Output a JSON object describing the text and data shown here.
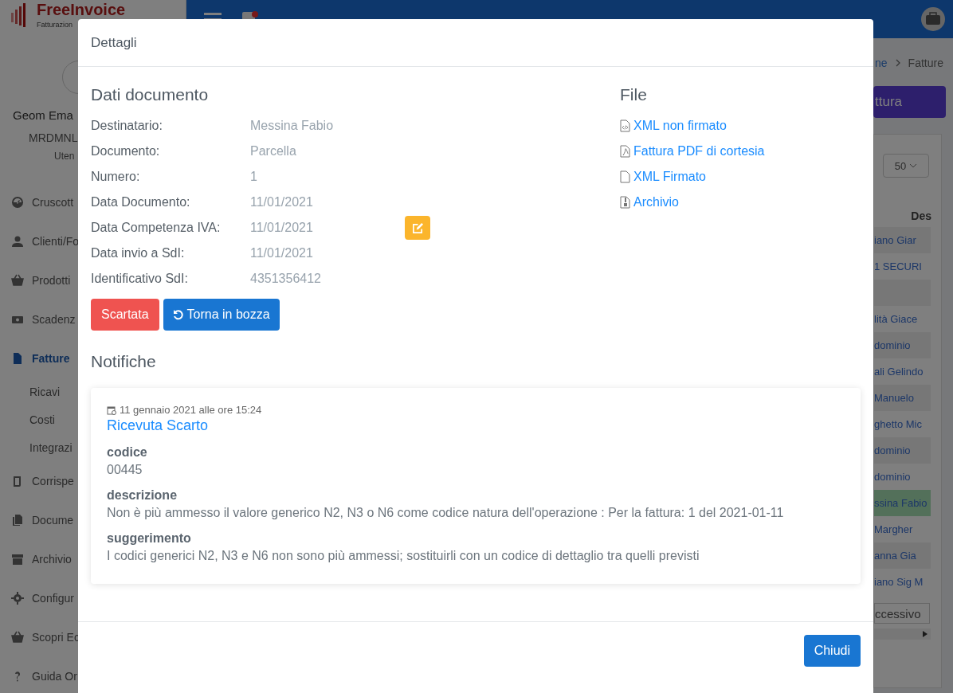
{
  "app": {
    "logo": {
      "name": "FreeInvoice",
      "tagline": "Fatturazion"
    },
    "user": {
      "name": "Geom Ema",
      "code": "MRDMNL",
      "role": "Uten"
    },
    "sidebar": {
      "items": [
        {
          "label": "Cruscott",
          "selected": false
        },
        {
          "label": "Clienti/Fo",
          "selected": false
        },
        {
          "label": "Prodotti",
          "selected": false
        },
        {
          "label": "Scadenz",
          "selected": false
        },
        {
          "label": "Fatture",
          "selected": true,
          "children": [
            {
              "label": "Ricavi"
            },
            {
              "label": "Costi"
            },
            {
              "label": "Integrazi"
            }
          ]
        },
        {
          "label": "Corrispe",
          "selected": false
        },
        {
          "label": "Docume",
          "selected": false
        },
        {
          "label": "Archivio",
          "selected": false
        },
        {
          "label": "Configur",
          "selected": false
        },
        {
          "label": "Scopri Ec",
          "selected": false
        },
        {
          "label": "Guida Or",
          "selected": false
        }
      ]
    }
  },
  "background": {
    "breadcrumb": [
      "ne",
      "Fatture"
    ],
    "new_button": "ttura",
    "page_size": "50",
    "column_header": "Des",
    "rows": [
      {
        "text": "iano Giar",
        "selected": false
      },
      {
        "text": "1 SECURI",
        "selected": false
      },
      {
        "selected": false
      },
      {
        "text": "lità Giace",
        "selected": false
      },
      {
        "text": "dominio",
        "selected": false
      },
      {
        "text": "ali Gelindo",
        "selected": false
      },
      {
        "text": "Manuelo",
        "selected": false
      },
      {
        "text": "ghetto Mic",
        "selected": false
      },
      {
        "text": "dominio",
        "selected": false
      },
      {
        "text": "dominio",
        "selected": false
      },
      {
        "text": "ssina Fabio",
        "selected": true
      },
      {
        "text": "Margher",
        "selected": false
      },
      {
        "text": "anna Gia",
        "selected": false
      },
      {
        "text": "iano Sig M",
        "selected": false
      }
    ],
    "next_button": "ccessivo"
  },
  "dialog": {
    "title": "Dettagli",
    "document": {
      "heading": "Dati documento",
      "fields": [
        {
          "label": "Destinatario:",
          "value": "Messina Fabio",
          "editable": false
        },
        {
          "label": "Documento:",
          "value": "Parcella",
          "editable": false
        },
        {
          "label": "Numero:",
          "value": "1",
          "editable": false
        },
        {
          "label": "Data Documento:",
          "value": "11/01/2021",
          "editable": false
        },
        {
          "label": "Data Competenza IVA:",
          "value": "11/01/2021",
          "editable": true
        },
        {
          "label": "Data invio a SdI:",
          "value": "11/01/2021",
          "editable": false
        },
        {
          "label": "Identificativo SdI:",
          "value": "4351356412",
          "editable": false
        }
      ],
      "status_button": "Scartata",
      "revert_button": "Torna in bozza"
    },
    "files": {
      "heading": "File",
      "links": [
        "XML non firmato",
        "Fattura PDF di cortesia",
        "XML Firmato",
        "Archivio"
      ]
    },
    "notifications": {
      "heading": "Notifiche",
      "items": [
        {
          "date": "11 gennaio 2021 alle ore 15:24",
          "title": "Ricevuta Scarto",
          "fields": [
            {
              "label": "codice",
              "value": "00445"
            },
            {
              "label": "descrizione",
              "value": "Non è più ammesso il valore generico N2, N3 o N6 come codice natura dell'operazione : Per la fattura: 1 del 2021-01-11"
            },
            {
              "label": "suggerimento",
              "value": "I codici generici N2, N3 e N6 non sono più ammessi; sostituirli con un codice di dettaglio tra quelli previsti"
            }
          ]
        }
      ]
    },
    "close_button": "Chiudi"
  }
}
